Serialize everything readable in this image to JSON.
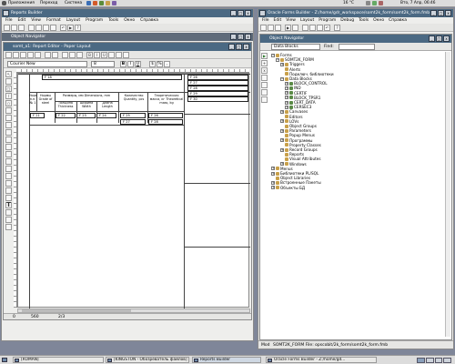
{
  "top_panel": {
    "menus": [
      "Приложения",
      "Переход",
      "Система"
    ],
    "temperature": "16 °C",
    "datetime": "Вто, 7 Апр, 06:46"
  },
  "reports_builder": {
    "title": "Reports Builder",
    "menus": [
      "File",
      "Edit",
      "View",
      "Format",
      "Layout",
      "Program",
      "Tools",
      "Окно",
      "Справка"
    ],
    "object_navigator_title": "Object Navigator",
    "editor_title": "somt_a1: Report Editor - Paper Layout",
    "font_name": "Courier New",
    "font_size": "8",
    "fields": {
      "f1": "F 18",
      "f2": "F 21",
      "f3": "F 22",
      "f4": "F 23",
      "f5": "F 24",
      "f6": "F 25",
      "f7": "F 26",
      "f8": "F 27",
      "f9": "F 28",
      "r1": "F 26",
      "r2": "F 27",
      "r3": "F 28",
      "r4": "F 29",
      "r5": "F 30"
    },
    "headers": {
      "h1": "Норм. п.п. № 1",
      "h2": "Нормы Grade of steel",
      "h3": "Размеры, мм Dimensions, mm",
      "h3a": "Толщина Thickness",
      "h3b": "Ширина Width",
      "h3c": "Длина Length",
      "h4": "Количество Quantity, pcs",
      "h5": "Теоретическая масса, кг Theoretical mass, kg"
    },
    "status_left": "0",
    "status_coords": "560",
    "status_coords2": "2/3"
  },
  "forms_builder": {
    "title": "Oracle Forms Builder - Z:/home/gdr_workspace/somt2k_form/somt2k_form.fmb",
    "menus": [
      "File",
      "Edit",
      "View",
      "Layout",
      "Program",
      "Debug",
      "Tools",
      "Окно",
      "Справка"
    ],
    "nav_title": "Object Navigator",
    "ownership_view": "Data Blocks",
    "find_label": "Find:",
    "tree": [
      {
        "label": "Forms",
        "level": 0,
        "expander": "-"
      },
      {
        "label": "SOMT2K_FORM",
        "level": 1,
        "expander": "-"
      },
      {
        "label": "Triggers",
        "level": 2,
        "expander": "+"
      },
      {
        "label": "Alerts",
        "level": 2,
        "expander": ""
      },
      {
        "label": "Подключ. библиотеки",
        "level": 2,
        "expander": ""
      },
      {
        "label": "Data Blocks",
        "level": 2,
        "expander": "-"
      },
      {
        "label": "BLOCK_CONTROL",
        "level": 3,
        "expander": "+"
      },
      {
        "label": "IND",
        "level": 3,
        "expander": "+"
      },
      {
        "label": "CERTIF",
        "level": 3,
        "expander": "+"
      },
      {
        "label": "BLOCK_TPSR1",
        "level": 3,
        "expander": "+"
      },
      {
        "label": "CERT_DATA",
        "level": 3,
        "expander": "+"
      },
      {
        "label": "CERSEC3",
        "level": 3,
        "expander": "+"
      },
      {
        "label": "Canvases",
        "level": 2,
        "expander": "+"
      },
      {
        "label": "Editors",
        "level": 2,
        "expander": ""
      },
      {
        "label": "LOVs",
        "level": 2,
        "expander": "+"
      },
      {
        "label": "Object Groups",
        "level": 2,
        "expander": ""
      },
      {
        "label": "Parameters",
        "level": 2,
        "expander": "+"
      },
      {
        "label": "Popup Menus",
        "level": 2,
        "expander": ""
      },
      {
        "label": "Программы",
        "level": 2,
        "expander": "+"
      },
      {
        "label": "Property Classes",
        "level": 2,
        "expander": ""
      },
      {
        "label": "Record Groups",
        "level": 2,
        "expander": "+"
      },
      {
        "label": "Reports",
        "level": 2,
        "expander": ""
      },
      {
        "label": "Visual Attributes",
        "level": 2,
        "expander": ""
      },
      {
        "label": "Windows",
        "level": 2,
        "expander": "+"
      },
      {
        "label": "Menus",
        "level": 0,
        "expander": "+"
      },
      {
        "label": "Библиотеки PL/SQL",
        "level": 0,
        "expander": "+"
      },
      {
        "label": "Object Libraries",
        "level": 0,
        "expander": ""
      },
      {
        "label": "Встроенные Пакеты",
        "level": 0,
        "expander": "+"
      },
      {
        "label": "Объекты БД",
        "level": 0,
        "expander": "+"
      }
    ],
    "status_left": "Mod",
    "status_text": "SOMT2K_FORM File: opscobit/2k_form/somt2k_form.fmb"
  },
  "taskbar": {
    "buttons": [
      {
        "label": "[ROMAN]",
        "active": false
      },
      {
        "label": "[KINGSTON - Обозреватель файлов]",
        "active": false
      },
      {
        "label": "Reports Builder",
        "active": true
      },
      {
        "label": "Oracle Forms Builder - Z:/home/gd...",
        "active": false
      }
    ]
  },
  "colors": {
    "desktop": "#7f8699",
    "title_active": "#4b6983",
    "title_inactive": "#5f6b7a",
    "tree_icon": "#c8a04a",
    "datablock_icon": "#5a8a46"
  }
}
